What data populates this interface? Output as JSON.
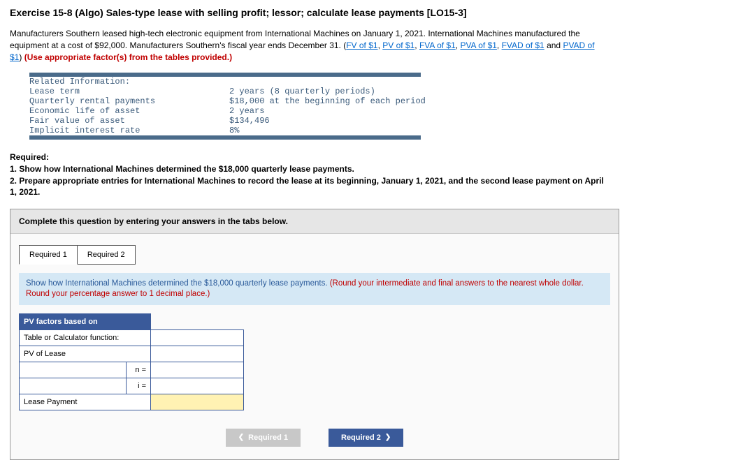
{
  "title": "Exercise 15-8 (Algo) Sales-type lease with selling profit; lessor; calculate lease payments [LO15-3]",
  "intro": {
    "p1a": "Manufacturers Southern leased high-tech electronic equipment from International Machines on January 1, 2021. International Machines manufactured the equipment at a cost of $92,000. Manufacturers Southern's fiscal year ends December 31. (",
    "l1": "FV of $1",
    "s1": ", ",
    "l2": "PV of $1",
    "s2": ", ",
    "l3": "FVA of $1",
    "s3": ", ",
    "l4": "PVA of $1",
    "s4": ", ",
    "l5": "FVAD of $1",
    "s5": " and ",
    "l6": "PVAD of $1",
    "p1b": ") ",
    "red": "(Use appropriate factor(s) from the tables provided.)"
  },
  "info": {
    "header": "Related Information:",
    "rows": [
      {
        "label": "Lease term",
        "value": "2 years (8 quarterly periods)"
      },
      {
        "label": "Quarterly rental payments",
        "value": "$18,000 at the beginning of each period"
      },
      {
        "label": "Economic life of asset",
        "value": "2 years"
      },
      {
        "label": "Fair value of asset",
        "value": "$134,496"
      },
      {
        "label": "Implicit interest rate",
        "value": "8%"
      }
    ]
  },
  "required": {
    "hdr": "Required:",
    "r1": "1. Show how International Machines determined the $18,000 quarterly lease payments.",
    "r2": "2. Prepare appropriate entries for International Machines to record the lease at its beginning, January 1, 2021, and the second lease payment on April 1, 2021."
  },
  "answer": {
    "instr": "Complete this question by entering your answers in the tabs below.",
    "tabs": {
      "t1": "Required 1",
      "t2": "Required 2"
    },
    "tabInstrMain": "Show how International Machines determined the $18,000 quarterly lease payments. ",
    "tabInstrRed": "(Round your intermediate and final answers to the nearest whole dollar. Round your percentage answer to 1 decimal place.)",
    "calc": {
      "hdr": "PV factors based on",
      "r1": "Table or Calculator function:",
      "r2": "PV of Lease",
      "n": "n =",
      "i": "i =",
      "r3": "Lease Payment"
    },
    "nav": {
      "prev": "Required 1",
      "next": "Required 2"
    }
  }
}
